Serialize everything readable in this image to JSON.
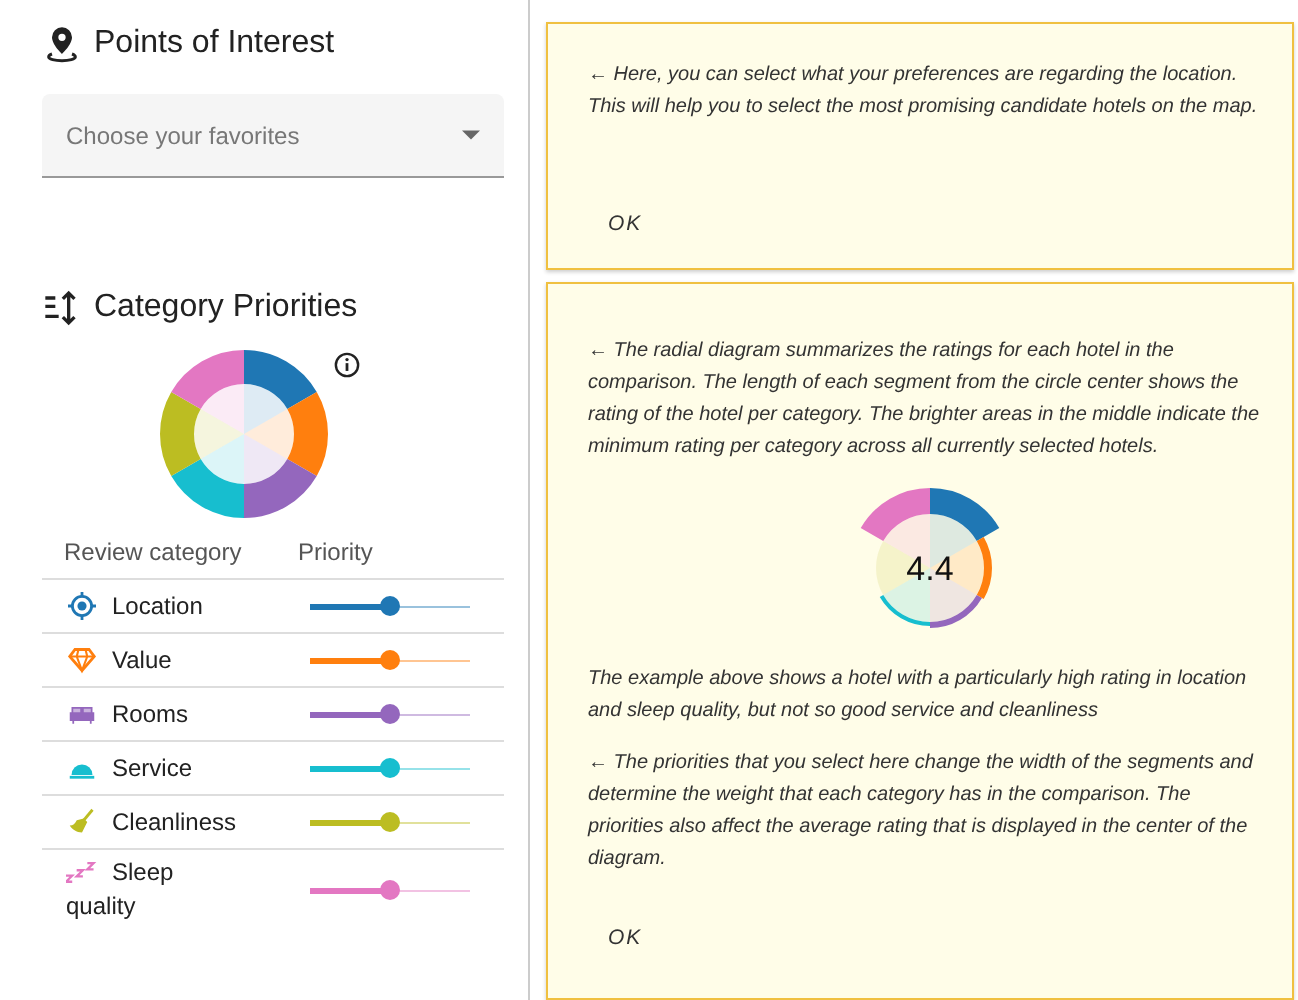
{
  "poi": {
    "title": "Points of Interest",
    "select": {
      "placeholder": "Choose your favorites"
    }
  },
  "priorities": {
    "title": "Category Priorities",
    "columns": [
      "Review category",
      "Priority"
    ],
    "categories": [
      {
        "name": "Location",
        "color": "#1f77b4",
        "level": 0.5
      },
      {
        "name": "Value",
        "color": "#ff7f0e",
        "level": 0.5
      },
      {
        "name": "Rooms",
        "color": "#9467bd",
        "level": 0.5
      },
      {
        "name": "Service",
        "color": "#17becf",
        "level": 0.5
      },
      {
        "name": "Cleanliness",
        "color": "#bcbd22",
        "level": 0.5
      },
      {
        "name": "Sleep quality",
        "color": "#e377c2",
        "level": 0.5
      }
    ]
  },
  "help_cards": [
    {
      "paragraphs": [
        {
          "text": "← Here, you can select what your preferences are regarding the location. This will help you to select the most promising candidate hotels on the map."
        }
      ],
      "button": "OK"
    },
    {
      "paragraphs": [
        {
          "text": "← The radial diagram summarizes the ratings for each hotel in the comparison. The length of each segment from the circle center shows the rating of the hotel per category. The brighter areas in the middle indicate the minimum rating per category across all currently selected hotels."
        },
        {
          "diagram_value": "4.4"
        },
        {
          "text": "The example above shows a hotel with a particularly high rating in location and sleep quality, but not so good service and cleanliness"
        },
        {
          "text": "← The priorities that you select here change the width of the segments and determine the weight that each category has in the comparison. The priorities also affect the average rating that is displayed in the center of the diagram."
        }
      ],
      "button": "OK"
    }
  ]
}
